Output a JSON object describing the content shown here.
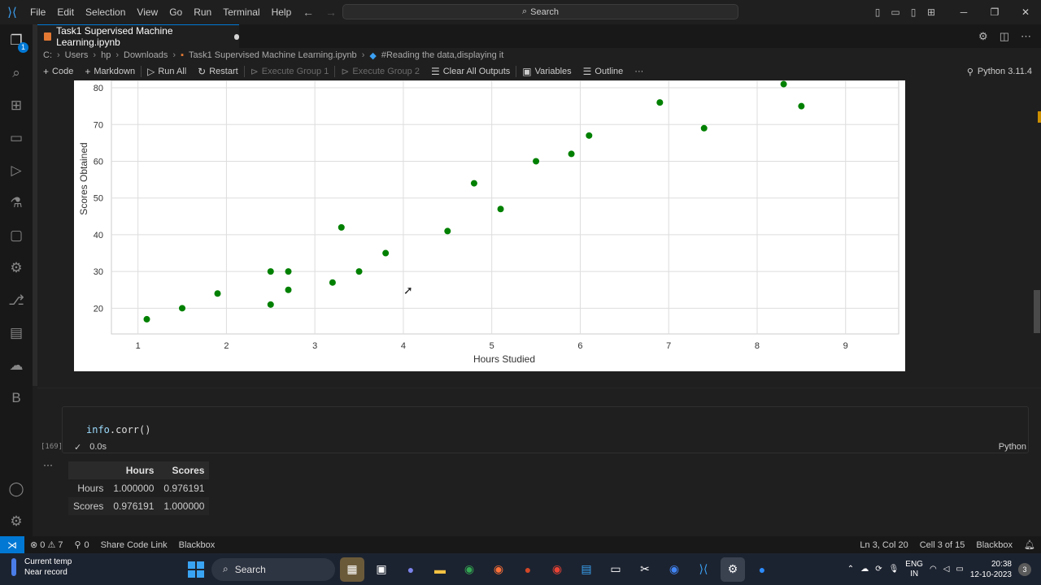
{
  "window": {
    "menu": [
      "File",
      "Edit",
      "Selection",
      "View",
      "Go",
      "Run",
      "Terminal",
      "Help"
    ],
    "search_label": "Search"
  },
  "tab": {
    "title": "Task1 Supervised Machine Learning.ipynb"
  },
  "breadcrumb": [
    "C:",
    "Users",
    "hp",
    "Downloads",
    "Task1 Supervised Machine Learning.ipynb",
    "#Reading the data,displaying it"
  ],
  "toolbar": {
    "code": "Code",
    "markdown": "Markdown",
    "run_all": "Run All",
    "restart": "Restart",
    "exec_group1": "Execute Group 1",
    "exec_group2": "Execute Group 2",
    "clear_outputs": "Clear All Outputs",
    "variables": "Variables",
    "outline": "Outline",
    "more": "···",
    "kernel": "Python 3.11.4"
  },
  "activity_badge": "1",
  "chart_data": {
    "type": "scatter",
    "xlabel": "Hours Studied",
    "ylabel": "Scores Obtained",
    "x_ticks": [
      1,
      2,
      3,
      4,
      5,
      6,
      7,
      8,
      9
    ],
    "y_ticks": [
      20,
      30,
      40,
      50,
      60,
      70,
      80
    ],
    "xlim": [
      0.7,
      9.6
    ],
    "ylim": [
      13,
      82
    ],
    "grid": true,
    "color": "#008000",
    "points": [
      [
        1.1,
        17
      ],
      [
        1.5,
        20
      ],
      [
        1.9,
        24
      ],
      [
        2.5,
        21
      ],
      [
        2.5,
        30
      ],
      [
        2.7,
        25
      ],
      [
        2.7,
        30
      ],
      [
        3.2,
        27
      ],
      [
        3.3,
        42
      ],
      [
        3.5,
        30
      ],
      [
        3.8,
        35
      ],
      [
        4.5,
        41
      ],
      [
        4.8,
        54
      ],
      [
        5.1,
        47
      ],
      [
        5.5,
        60
      ],
      [
        5.9,
        62
      ],
      [
        6.1,
        67
      ],
      [
        6.9,
        76
      ],
      [
        7.4,
        69
      ],
      [
        8.3,
        81
      ],
      [
        8.5,
        75
      ]
    ]
  },
  "cell": {
    "code_obj": "info",
    "code_call": ".corr()",
    "exec_count": "[169]",
    "check": "✓",
    "duration": "0.0s",
    "language": "Python"
  },
  "output": {
    "more": "···",
    "columns": [
      "Hours",
      "Scores"
    ],
    "rows": [
      {
        "label": "Hours",
        "values": [
          "1.000000",
          "0.976191"
        ]
      },
      {
        "label": "Scores",
        "values": [
          "0.976191",
          "1.000000"
        ]
      }
    ]
  },
  "statusbar": {
    "problems": "⊗ 0 ⚠ 7",
    "ports": "0",
    "share": "Share Code Link",
    "blackbox": "Blackbox",
    "position": "Ln 3, Col 20",
    "cell_info": "Cell 3 of 15",
    "blackbox_right": "Blackbox"
  },
  "taskbar": {
    "weather_line1": "Current temp",
    "weather_line2": "Near record",
    "search": "Search",
    "lang_line1": "ENG",
    "lang_line2": "IN",
    "time": "20:38",
    "date": "12-10-2023",
    "notifications": "3"
  }
}
